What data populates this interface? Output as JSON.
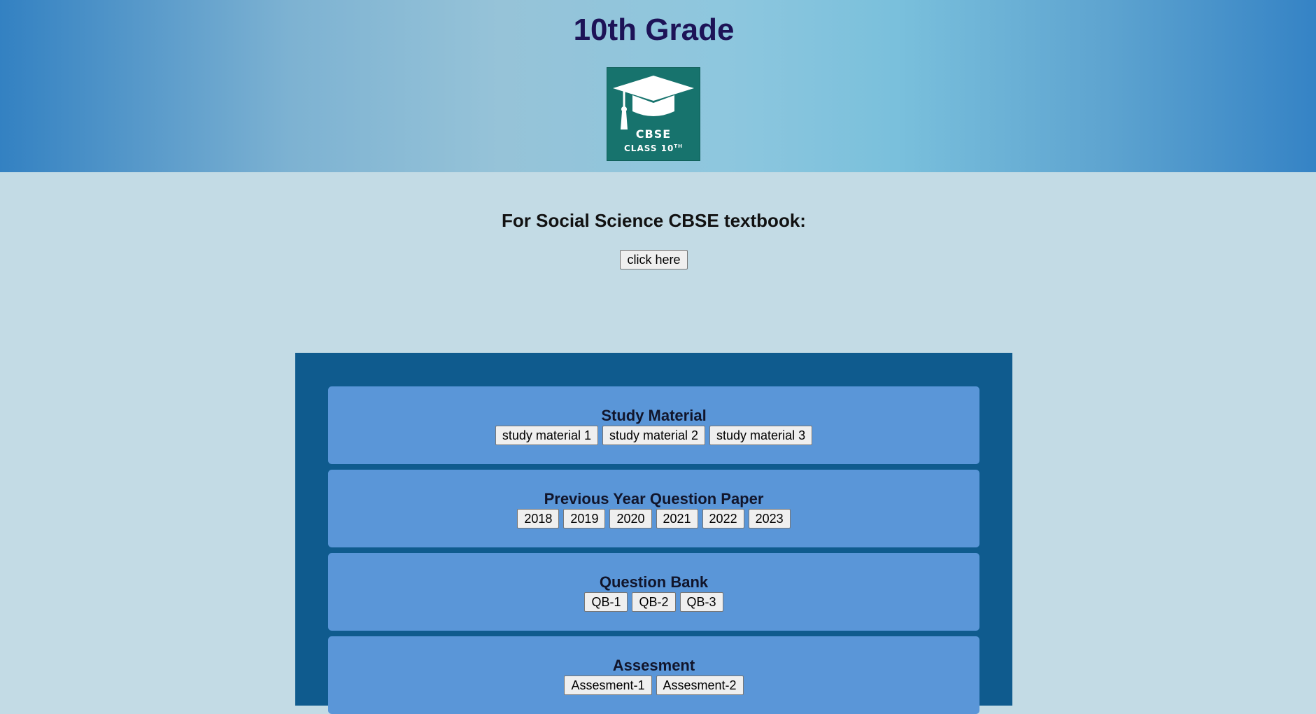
{
  "header": {
    "title": "10th Grade",
    "logo": {
      "cbse_text": "CBSE",
      "class_text": "CLASS 10",
      "class_sup": "TH",
      "icon": "graduation-cap-icon",
      "bg_color": "#17736d"
    }
  },
  "main": {
    "subtitle": "For Social Science CBSE textbook:",
    "cta_label": "click here"
  },
  "sections": [
    {
      "title": "Study Material",
      "buttons": [
        "study material 1",
        "study material 2",
        "study material 3"
      ]
    },
    {
      "title": "Previous Year Question Paper",
      "buttons": [
        "2018",
        "2019",
        "2020",
        "2021",
        "2022",
        "2023"
      ]
    },
    {
      "title": "Question Bank",
      "buttons": [
        "QB-1",
        "QB-2",
        "QB-3"
      ]
    },
    {
      "title": "Assesment",
      "buttons": [
        "Assesment-1",
        "Assesment-2"
      ]
    }
  ],
  "colors": {
    "page_bg": "#c3dbe5",
    "panel_bg": "#0f5b8e",
    "card_bg": "#5a96d8",
    "title_color": "#1d1357"
  }
}
